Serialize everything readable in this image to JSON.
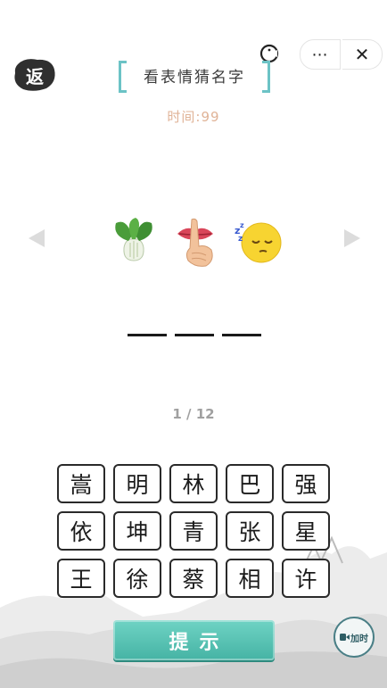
{
  "capsule": {
    "more_icon": "⋯",
    "close_icon": "✕"
  },
  "back_button": {
    "label": "返"
  },
  "title": "看表情猜名字",
  "timer": "时间:99",
  "emojis": [
    "bok-choy-icon",
    "shush-finger-lips-icon",
    "sleeping-face-icon"
  ],
  "answer_slots": 3,
  "progress": "1 / 12",
  "grid": [
    [
      "嵩",
      "明",
      "林",
      "巴",
      "强"
    ],
    [
      "依",
      "坤",
      "青",
      "张",
      "星"
    ],
    [
      "王",
      "徐",
      "蔡",
      "相",
      "许"
    ]
  ],
  "hint_button": "提示",
  "add_time": "加时",
  "colors": {
    "accent": "#6cc3c6",
    "timer": "#e0b397",
    "hint": "#45b3a4"
  }
}
